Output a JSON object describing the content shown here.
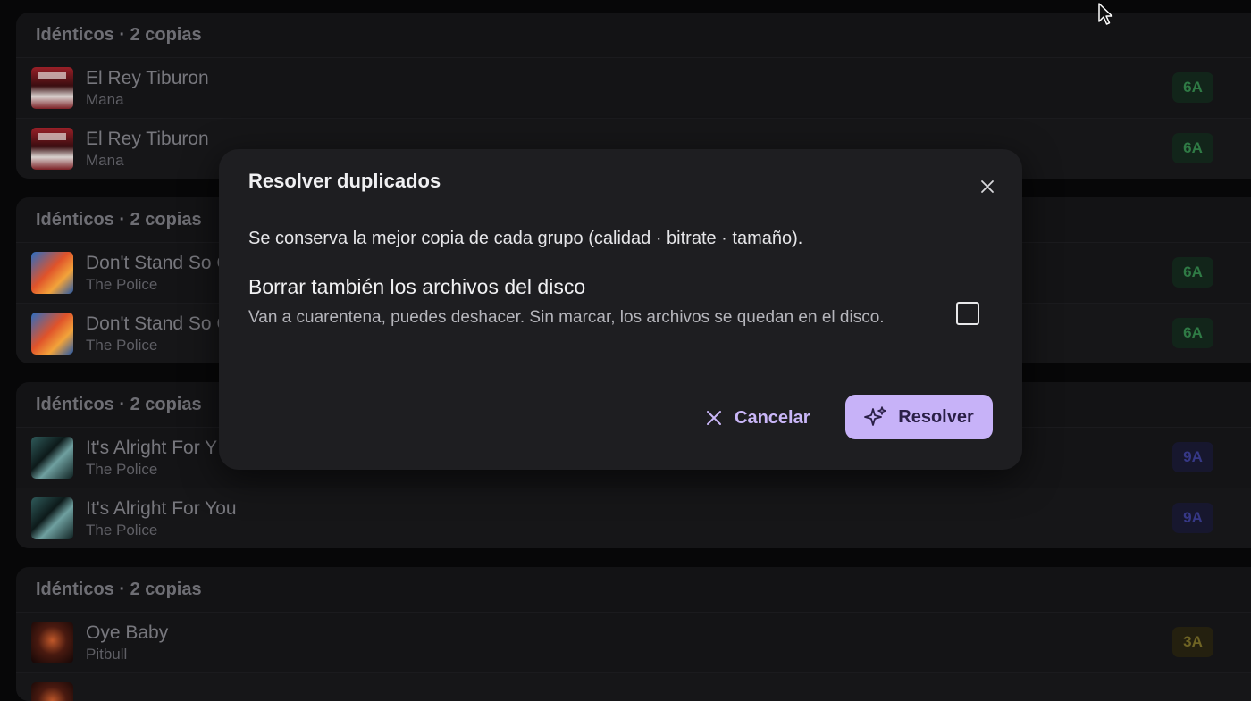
{
  "groups": [
    {
      "header": "Idénticos · 2 copias",
      "tracks": [
        {
          "title": "El Rey Tiburon",
          "artist": "Mana",
          "key": "6A"
        },
        {
          "title": "El Rey Tiburon",
          "artist": "Mana",
          "key": "6A"
        }
      ]
    },
    {
      "header": "Idénticos · 2 copias",
      "tracks": [
        {
          "title": "Don't Stand So C",
          "artist": "The Police",
          "key": "6A"
        },
        {
          "title": "Don't Stand So C",
          "artist": "The Police",
          "key": "6A"
        }
      ]
    },
    {
      "header": "Idénticos · 2 copias",
      "tracks": [
        {
          "title": "It's Alright For Y",
          "artist": "The Police",
          "key": "9A"
        },
        {
          "title": "It's Alright For You",
          "artist": "The Police",
          "key": "9A"
        }
      ]
    },
    {
      "header": "Idénticos · 2 copias",
      "tracks": [
        {
          "title": "Oye Baby",
          "artist": "Pitbull",
          "key": "3A"
        }
      ]
    }
  ],
  "modal": {
    "title": "Resolver duplicados",
    "description": "Se conserva la mejor copia de cada grupo (calidad · bitrate · tamaño).",
    "option_title": "Borrar también los archivos del disco",
    "option_description": "Van a cuarentena, puedes deshacer. Sin marcar, los archivos se quedan en el disco.",
    "option_checked": false,
    "cancel_label": "Cancelar",
    "resolve_label": "Resolver"
  },
  "colors": {
    "accent": "#c7b2f8",
    "key_6A": "#2f7a45",
    "key_9A": "#363886",
    "key_3A": "#6f6424"
  },
  "icons": {
    "close": "close-icon",
    "cancel": "x-icon",
    "resolve": "sparkles-icon"
  }
}
